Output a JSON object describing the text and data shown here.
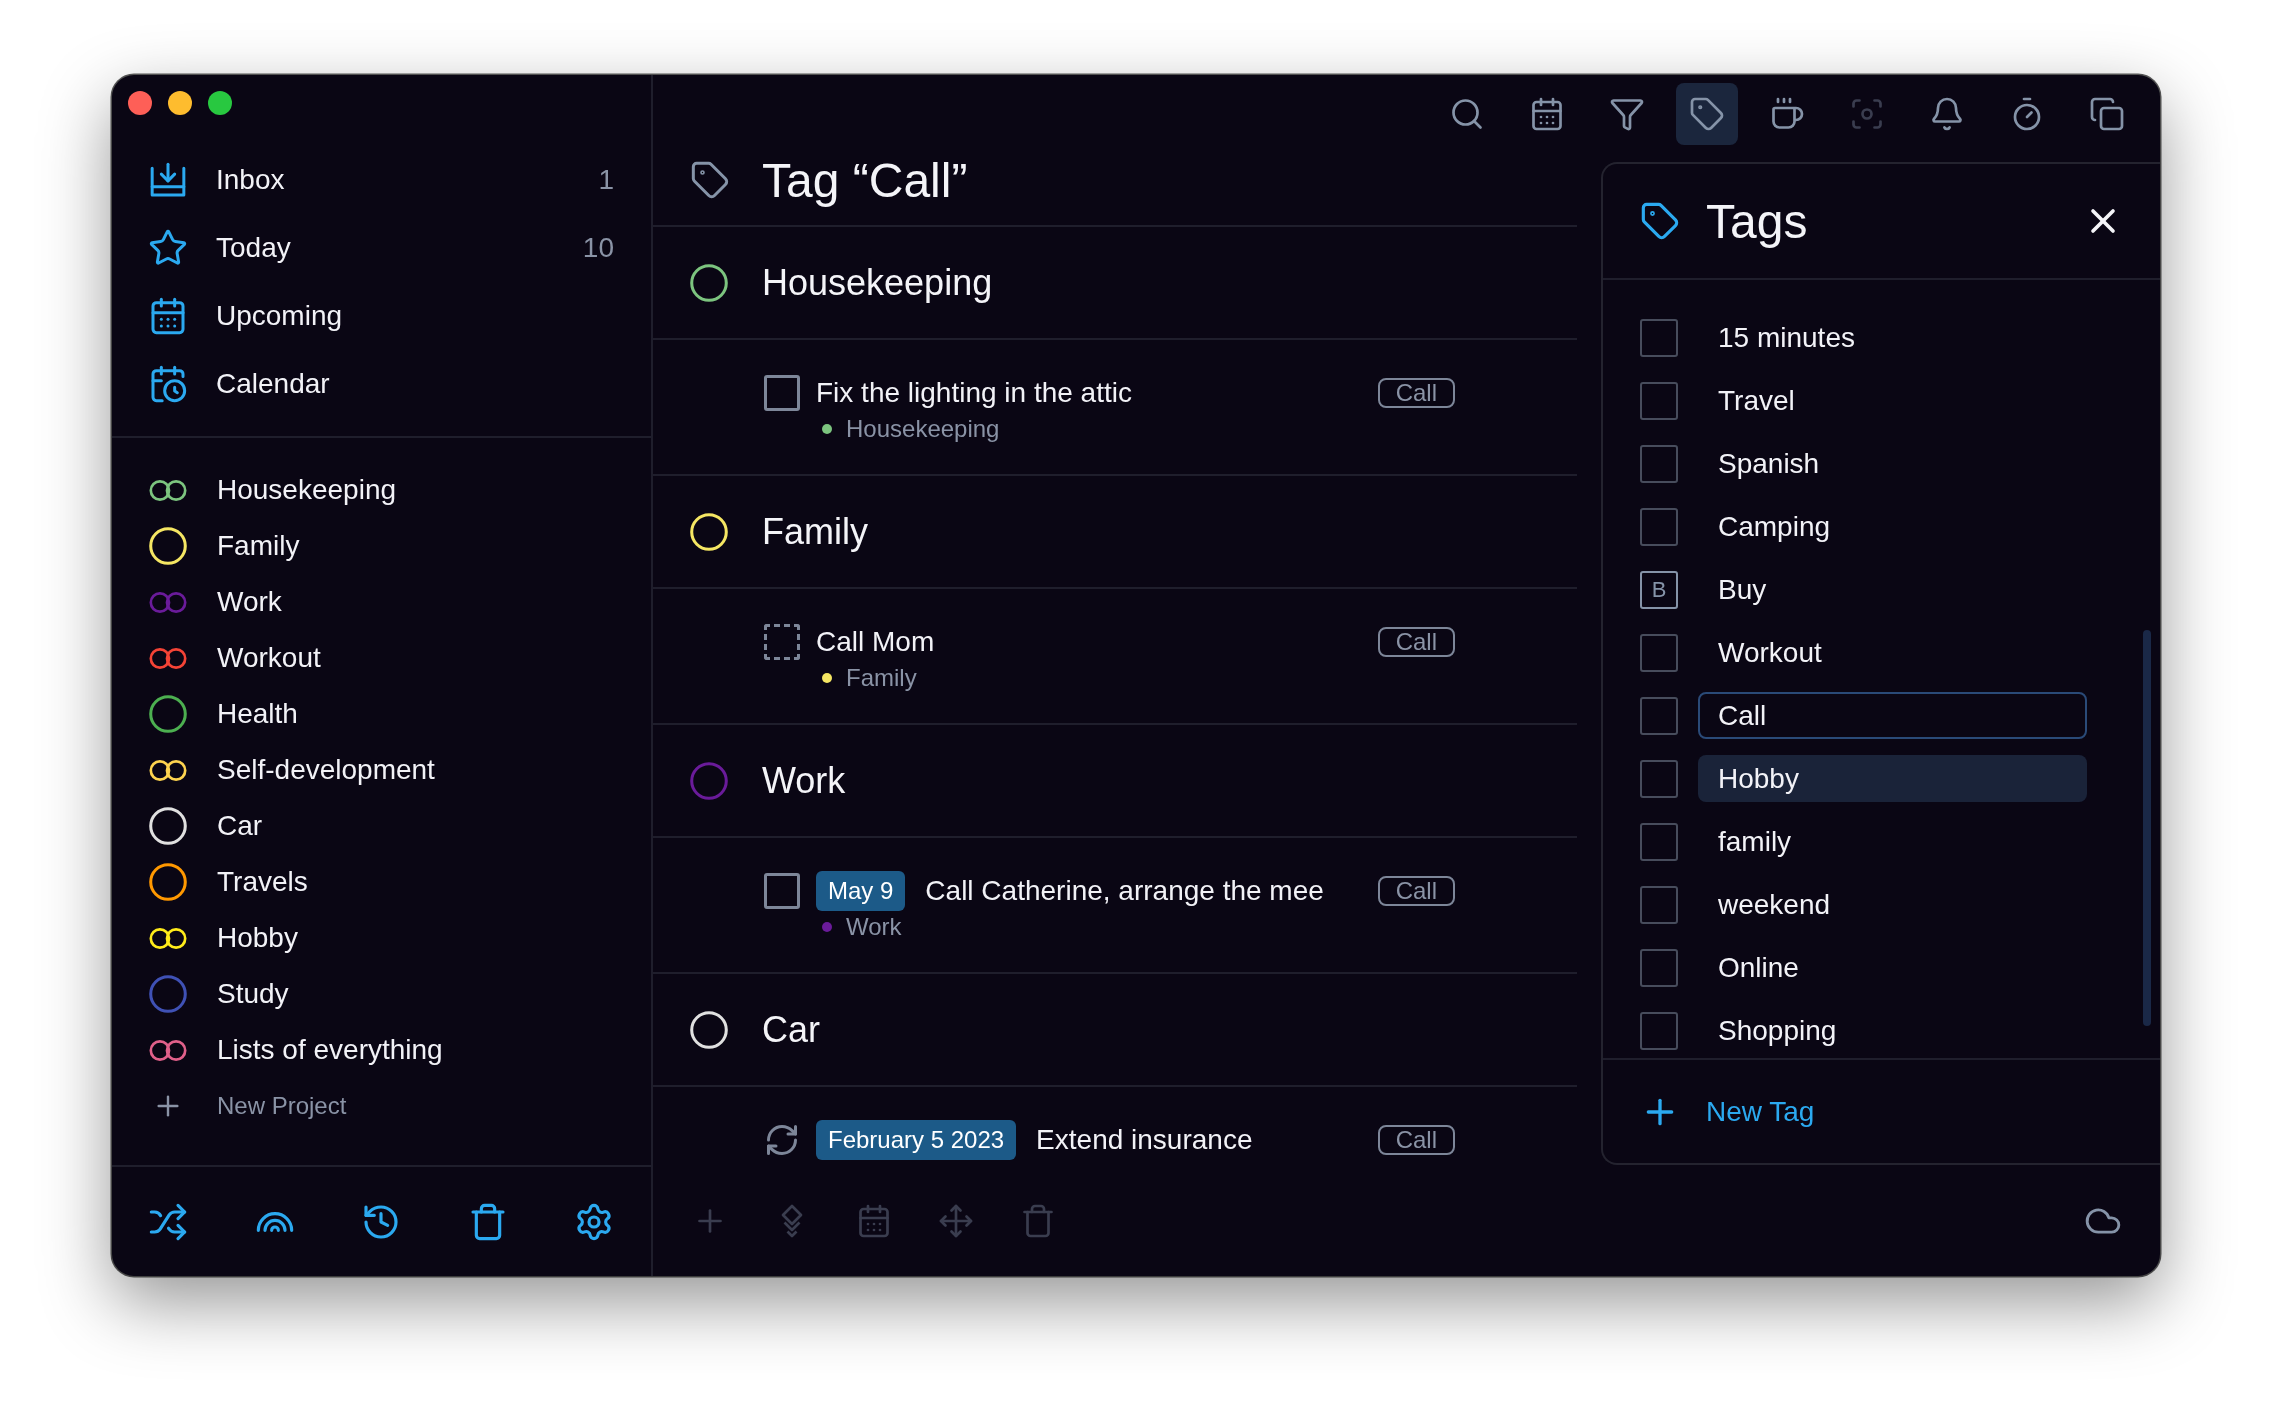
{
  "sidebar": {
    "nav": [
      {
        "label": "Inbox",
        "count": "1",
        "selected": false
      },
      {
        "label": "Today",
        "count": "10",
        "selected": false
      },
      {
        "label": "Upcoming",
        "selected": false
      },
      {
        "label": "Calendar",
        "selected": false
      }
    ],
    "projects": [
      {
        "name": "Housekeeping",
        "kind": "double",
        "color": "#7cc47f",
        "selected": false
      },
      {
        "name": "Family",
        "kind": "single",
        "color": "#f5e663",
        "selected": false
      },
      {
        "name": "Work",
        "kind": "double",
        "color": "#6a1b9a",
        "selected": false
      },
      {
        "name": "Workout",
        "kind": "double",
        "color": "#f44336",
        "selected": false
      },
      {
        "name": "Health",
        "kind": "single",
        "color": "#4caf50",
        "selected": false
      },
      {
        "name": "Self-development",
        "kind": "double",
        "color": "#fdd34f",
        "selected": false
      },
      {
        "name": "Car",
        "kind": "single",
        "color": "#e0e0e0",
        "selected": false
      },
      {
        "name": "Travels",
        "kind": "single",
        "color": "#ff9800",
        "selected": false
      },
      {
        "name": "Hobby",
        "kind": "double",
        "color": "#ffeb1a",
        "selected": false
      },
      {
        "name": "Study",
        "kind": "single",
        "color": "#3f51b5",
        "selected": false
      },
      {
        "name": "Lists of everything",
        "kind": "double",
        "color": "#e0608a",
        "selected": false
      }
    ],
    "new_project": "New Project"
  },
  "toolbar": [
    {
      "selected": false,
      "disabled": false
    },
    {
      "selected": false,
      "disabled": false
    },
    {
      "selected": false,
      "disabled": false
    },
    {
      "selected": true,
      "disabled": false
    },
    {
      "selected": false,
      "disabled": false
    },
    {
      "selected": false,
      "disabled": true
    },
    {
      "selected": false,
      "disabled": false
    },
    {
      "selected": false,
      "disabled": false
    },
    {
      "selected": false,
      "disabled": false
    }
  ],
  "main": {
    "title": "Tag “Call”",
    "groups": [
      {
        "name": "Housekeeping",
        "color": "#7cc47f",
        "tasks": [
          {
            "kind": "box",
            "checked": false,
            "title": "Fix the lighting in the attic",
            "project": {
              "name": "Housekeeping",
              "color": "#7cc47f"
            },
            "tag": "Call"
          }
        ]
      },
      {
        "name": "Family",
        "color": "#f5e663",
        "tasks": [
          {
            "kind": "dashed",
            "checked": false,
            "title": "Call Mom",
            "project": {
              "name": "Family",
              "color": "#f5e663"
            },
            "tag": "Call"
          }
        ]
      },
      {
        "name": "Work",
        "color": "#6a1b9a",
        "tasks": [
          {
            "kind": "box",
            "checked": false,
            "date": "May 9",
            "title": "Call Catherine, arrange the mee",
            "project": {
              "name": "Work",
              "color": "#6a1b9a"
            },
            "tag": "Call"
          }
        ]
      },
      {
        "name": "Car",
        "color": "#e0e0e0",
        "tasks": [
          {
            "kind": "repeat",
            "checked": false,
            "date": "February 5 2023",
            "title": "Extend insurance",
            "tag": "Call"
          }
        ]
      }
    ]
  },
  "bottom_toolbar": [
    {
      "disabled": true
    },
    {
      "disabled": true
    },
    {
      "disabled": true
    },
    {
      "disabled": true
    },
    {
      "disabled": true
    }
  ],
  "tags_panel": {
    "title": "Tags",
    "items": [
      {
        "label": "15 minutes",
        "kind": "checkbox",
        "checked": false,
        "selected": false,
        "focused": false
      },
      {
        "label": "Travel",
        "kind": "checkbox",
        "checked": false,
        "selected": false,
        "focused": false
      },
      {
        "label": "Spanish",
        "kind": "checkbox",
        "checked": false,
        "selected": false,
        "focused": false
      },
      {
        "label": "Camping",
        "kind": "checkbox",
        "checked": false,
        "selected": false,
        "focused": false
      },
      {
        "label": "Buy",
        "kind": "key",
        "key": "B",
        "selected": false,
        "focused": false
      },
      {
        "label": "Workout",
        "kind": "checkbox",
        "checked": false,
        "selected": false,
        "focused": false
      },
      {
        "label": "Call",
        "kind": "checkbox",
        "checked": false,
        "selected": false,
        "focused": true
      },
      {
        "label": "Hobby",
        "kind": "checkbox",
        "checked": false,
        "selected": true,
        "focused": false
      },
      {
        "label": "family",
        "kind": "checkbox",
        "checked": false,
        "selected": false,
        "focused": false
      },
      {
        "label": "weekend",
        "kind": "checkbox",
        "checked": false,
        "selected": false,
        "focused": false
      },
      {
        "label": "Online",
        "kind": "checkbox",
        "checked": false,
        "selected": false,
        "focused": false
      },
      {
        "label": "Shopping",
        "kind": "checkbox",
        "checked": false,
        "selected": false,
        "focused": false
      }
    ],
    "new_tag": "New Tag"
  }
}
